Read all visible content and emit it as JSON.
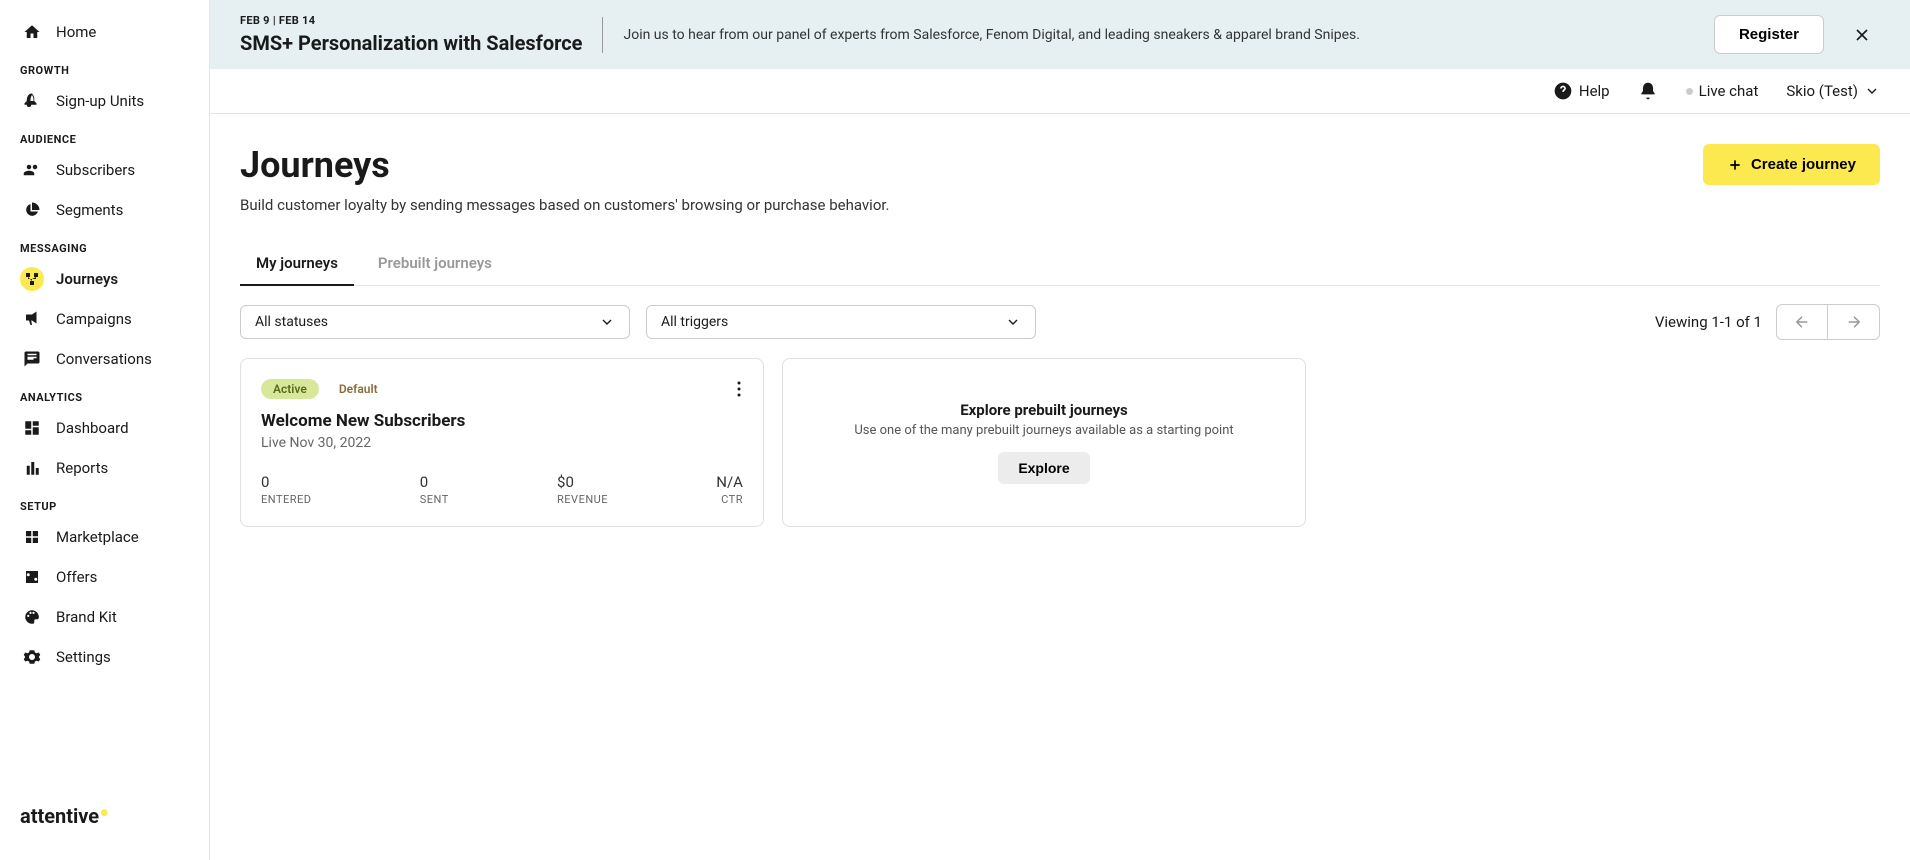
{
  "sidebar": {
    "home": "Home",
    "sections": {
      "growth": "GROWTH",
      "audience": "AUDIENCE",
      "messaging": "MESSAGING",
      "analytics": "ANALYTICS",
      "setup": "SETUP"
    },
    "items": {
      "signup_units": "Sign-up Units",
      "subscribers": "Subscribers",
      "segments": "Segments",
      "journeys": "Journeys",
      "campaigns": "Campaigns",
      "conversations": "Conversations",
      "dashboard": "Dashboard",
      "reports": "Reports",
      "marketplace": "Marketplace",
      "offers": "Offers",
      "brand_kit": "Brand Kit",
      "settings": "Settings"
    },
    "logo": "attentive"
  },
  "banner": {
    "date": "FEB 9 | FEB 14",
    "title": "SMS+ Personalization with Salesforce",
    "description": "Join us to hear from our panel of experts from Salesforce, Fenom Digital, and leading sneakers & apparel brand Snipes.",
    "register_btn": "Register"
  },
  "topbar": {
    "help": "Help",
    "live_chat": "Live chat",
    "account": "Skio (Test)"
  },
  "page": {
    "title": "Journeys",
    "subtitle": "Build customer loyalty by sending messages based on customers' browsing or purchase behavior.",
    "create_btn": "Create journey",
    "tabs": {
      "my_journeys": "My journeys",
      "prebuilt": "Prebuilt journeys"
    },
    "filters": {
      "status": "All statuses",
      "triggers": "All triggers"
    },
    "pagination": "Viewing 1-1 of 1"
  },
  "journey_card": {
    "badge_active": "Active",
    "badge_default": "Default",
    "title": "Welcome New Subscribers",
    "subtitle": "Live Nov 30, 2022",
    "stats": {
      "entered": {
        "value": "0",
        "label": "ENTERED"
      },
      "sent": {
        "value": "0",
        "label": "SENT"
      },
      "revenue": {
        "value": "$0",
        "label": "REVENUE"
      },
      "ctr": {
        "value": "N/A",
        "label": "CTR"
      }
    }
  },
  "explore_card": {
    "title": "Explore prebuilt journeys",
    "description": "Use one of the many prebuilt journeys available as a starting point",
    "button": "Explore"
  }
}
